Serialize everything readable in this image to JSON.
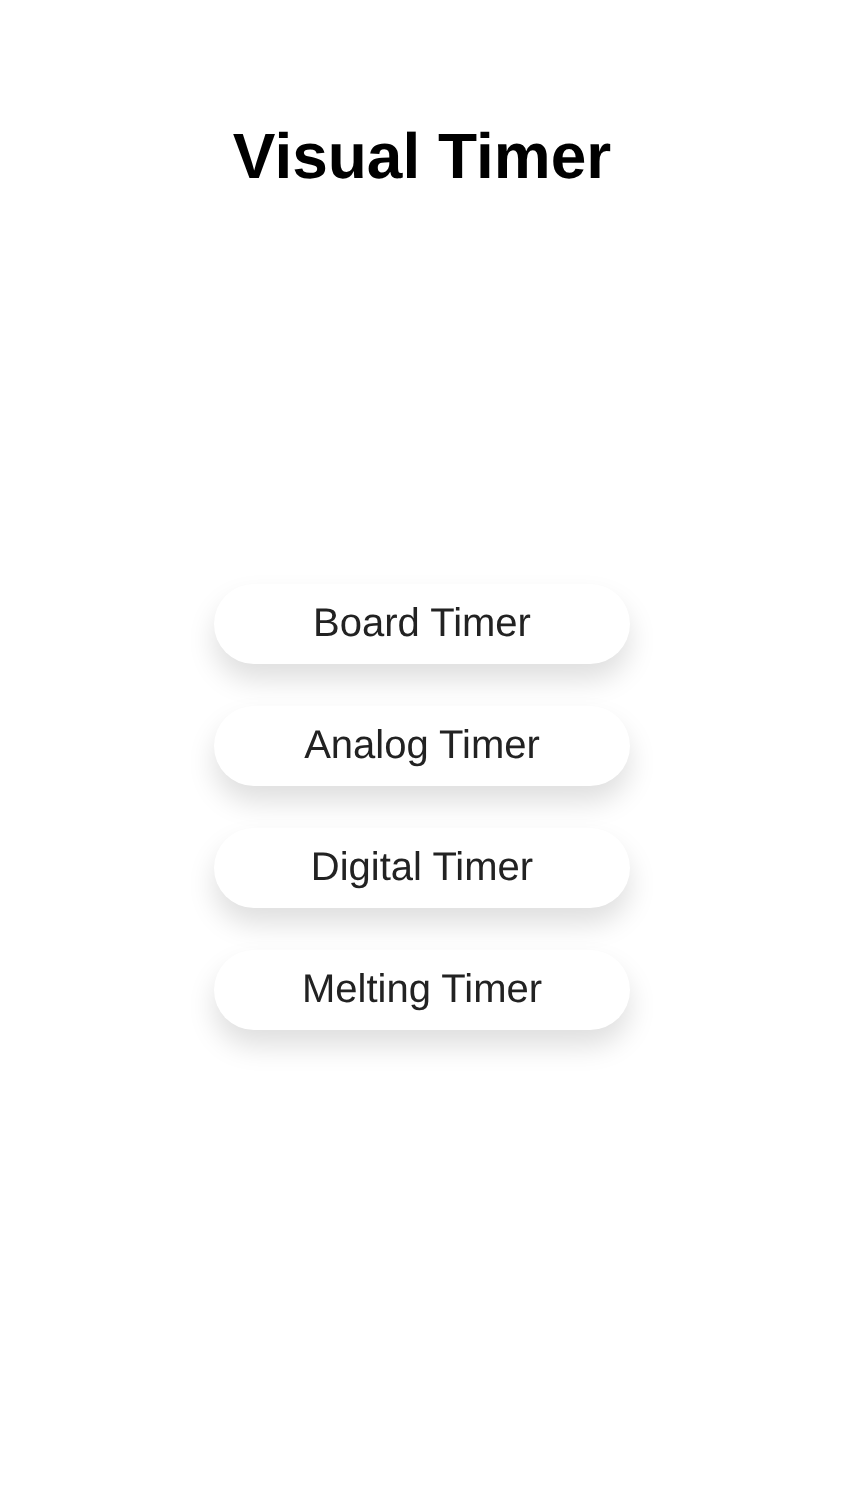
{
  "title": "Visual Timer",
  "buttons": [
    {
      "label": "Board Timer"
    },
    {
      "label": "Analog Timer"
    },
    {
      "label": "Digital Timer"
    },
    {
      "label": "Melting Timer"
    }
  ]
}
